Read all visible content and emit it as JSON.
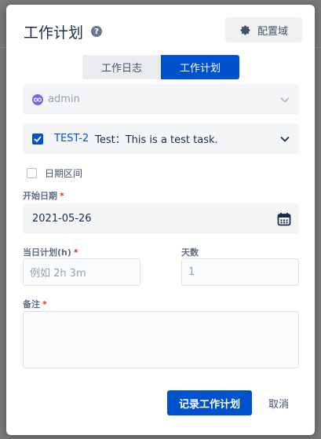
{
  "modal": {
    "title": "工作计划",
    "help_icon": "question-circle-icon",
    "config_button": {
      "label": "配置域",
      "icon": "gear-icon"
    }
  },
  "tabs": [
    {
      "label": "工作日志",
      "active": false
    },
    {
      "label": "工作计划",
      "active": true
    }
  ],
  "user_select": {
    "value": "admin",
    "icon": "user-avatar-icon"
  },
  "issue_select": {
    "checked": true,
    "key": "TEST-2",
    "summary": "Test：This is a test task."
  },
  "date_range": {
    "label": "日期区间",
    "checked": false
  },
  "start_date": {
    "label": "开始日期",
    "required_mark": "*",
    "value": "2021-05-26",
    "icon": "calendar-icon"
  },
  "daily_plan": {
    "label": "当日计划(h)",
    "required_mark": "*",
    "placeholder": "例如 2h 3m"
  },
  "days": {
    "label": "天数",
    "placeholder": "1"
  },
  "remarks": {
    "label": "备注",
    "required_mark": "*",
    "value": ""
  },
  "footer": {
    "submit_label": "记录工作计划",
    "cancel_label": "取消"
  },
  "colors": {
    "primary": "#0052cc",
    "required": "#de350b",
    "field_bg": "#f4f5f7"
  }
}
